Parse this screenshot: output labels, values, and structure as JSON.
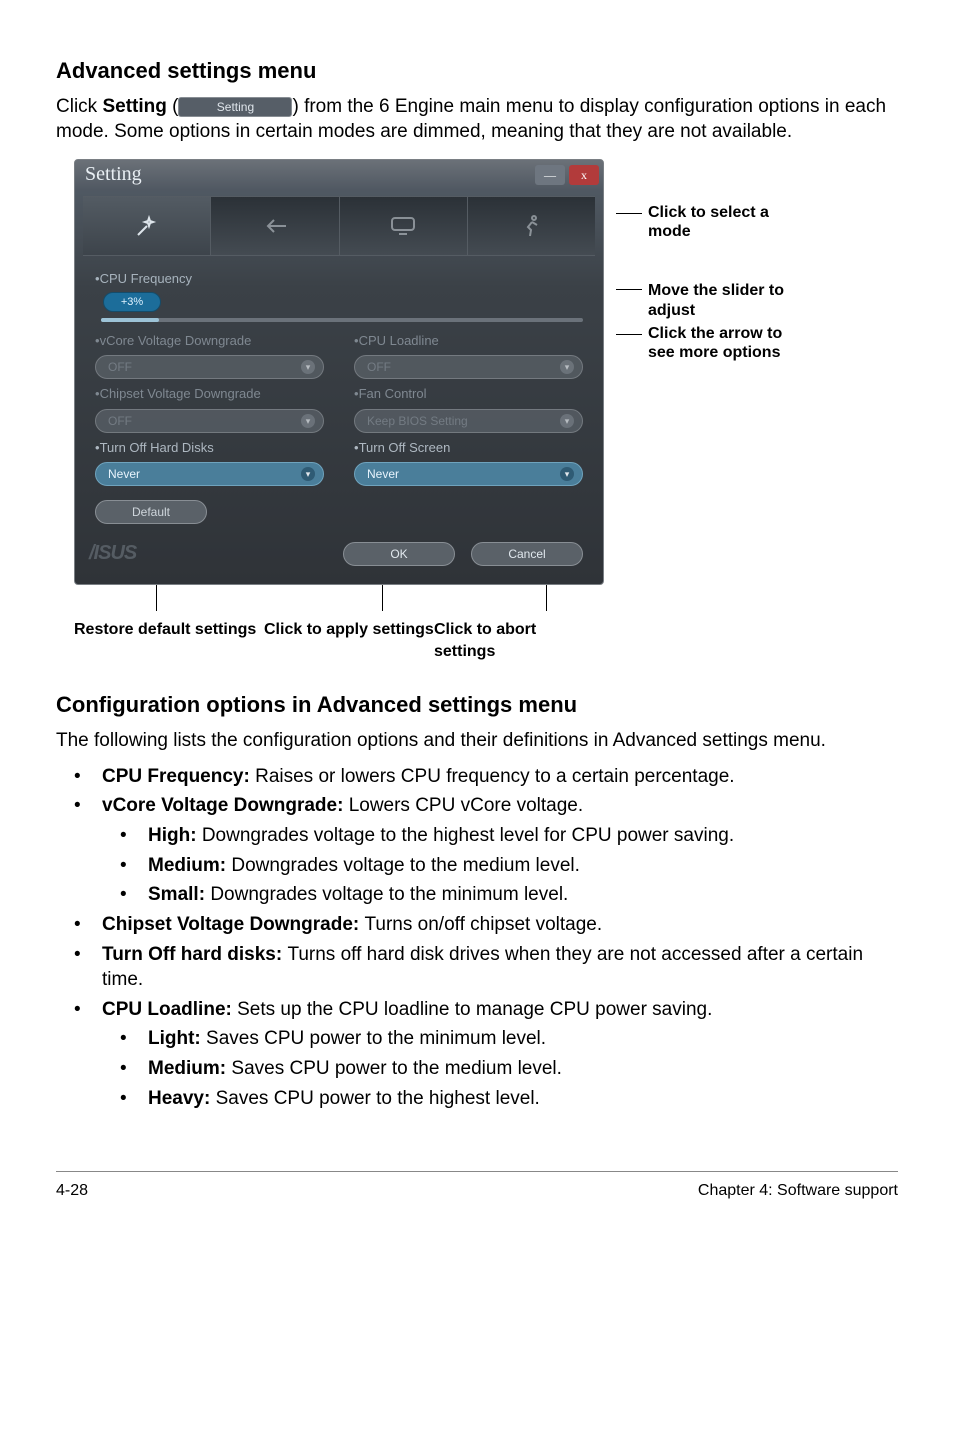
{
  "headings": {
    "adv": "Advanced settings menu",
    "conf": "Configuration options in Advanced settings menu"
  },
  "intro": {
    "click": "Click ",
    "setting_bold": "Setting",
    "open_paren": " (",
    "chip_label": "Setting",
    "close_paren": ") ",
    "rest": "from the 6 Engine main menu to display configuration options in each mode. Some options in certain modes are dimmed, meaning that they are not available."
  },
  "window": {
    "title": "Setting",
    "min": "—",
    "close": "x",
    "section_cpu": "CPU Frequency",
    "slider_label": "+3%",
    "left": {
      "vcore": "vCore Voltage Downgrade",
      "vcore_val": "OFF",
      "chipset": "Chipset Voltage Downgrade",
      "chipset_val": "OFF",
      "hdd": "Turn Off Hard Disks",
      "hdd_val": "Never"
    },
    "right": {
      "loadline": "CPU Loadline",
      "loadline_val": "OFF",
      "fan": "Fan Control",
      "fan_val": "Keep BIOS Setting",
      "screen": "Turn Off Screen",
      "screen_val": "Never"
    },
    "default_btn": "Default",
    "ok": "OK",
    "cancel": "Cancel"
  },
  "callouts": {
    "mode": "Click to select a mode",
    "slider": "Move the slider to adjust",
    "arrow": "Click the arrow to see more options"
  },
  "footer_labels": {
    "restore": "Restore default settings",
    "apply": "Click to apply settings",
    "abort": "Click to abort settings"
  },
  "conf_intro": "The following lists the configuration options and their definitions in Advanced settings menu.",
  "defs": {
    "cpu_b": "CPU Frequency: ",
    "cpu_t": "Raises or lowers CPU frequency to a certain percentage.",
    "vcore_b": "vCore Voltage Downgrade: ",
    "vcore_t": "Lowers CPU vCore voltage.",
    "high_b": "High: ",
    "high_t": "Downgrades voltage to the highest level for CPU power saving.",
    "med_b": "Medium: ",
    "med_t": "Downgrades voltage to the medium level.",
    "small_b": "Small: ",
    "small_t": "Downgrades voltage to the minimum level.",
    "chip_b": "Chipset Voltage Downgrade: ",
    "chip_t": "Turns on/off chipset voltage.",
    "hdd_b": "Turn Off hard disks: ",
    "hdd_t": "Turns off hard disk drives when they are not accessed after a certain time.",
    "load_b": "CPU Loadline: ",
    "load_t": "Sets up the CPU loadline to manage CPU power saving.",
    "light_b": "Light: ",
    "light_t": "Saves CPU power to the minimum level.",
    "lmed_b": "Medium: ",
    "lmed_t": "Saves CPU power to the medium level.",
    "heavy_b": "Heavy: ",
    "heavy_t": "Saves CPU power to the highest level."
  },
  "pagefoot": {
    "left": "4-28",
    "right": "Chapter 4: Software support"
  },
  "icons": {
    "wand": "wand-icon",
    "arrow_left": "arrow-left-icon",
    "monitor": "monitor-icon",
    "runner": "runner-icon",
    "chevron": "chevron-down-icon"
  }
}
